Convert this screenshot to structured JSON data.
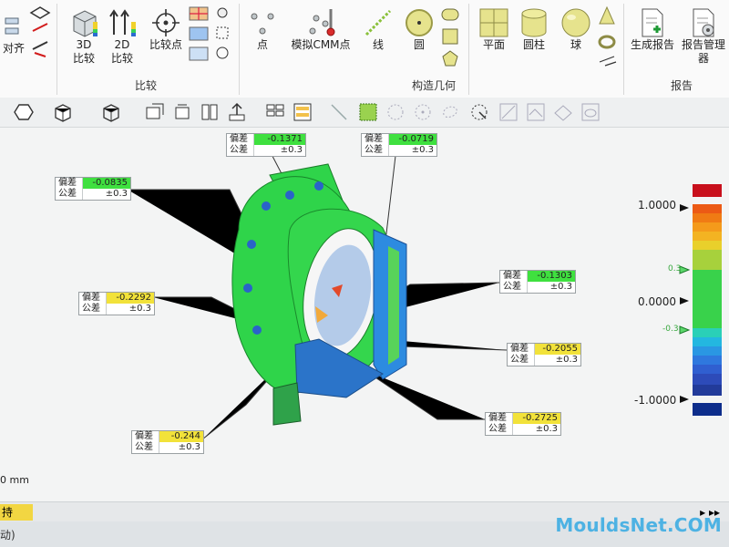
{
  "ribbon": {
    "left_cut_label": "对齐",
    "btn_3d_compare": "3D\n比较",
    "btn_2d_compare": "2D\n比较",
    "btn_compare_point": "比较点",
    "btn_point": "点",
    "btn_sim_cmm": "模拟CMM点",
    "btn_line": "线",
    "btn_circle": "圆",
    "btn_plane": "平面",
    "btn_cylinder": "圆柱",
    "btn_sphere": "球",
    "btn_gen_report": "生成报告",
    "btn_report_mgr": "报告管理器",
    "group_compare": "比较",
    "group_construct": "构造几何",
    "group_report": "报告"
  },
  "labels": {
    "dev": "偏差",
    "tol": "公差"
  },
  "callouts": [
    {
      "dev": "-0.1371",
      "tol": "±0.3",
      "hl": "green"
    },
    {
      "dev": "-0.0719",
      "tol": "±0.3",
      "hl": "green"
    },
    {
      "dev": "-0.0835",
      "tol": "±0.3",
      "hl": "green"
    },
    {
      "dev": "-0.2292",
      "tol": "±0.3",
      "hl": "yellow"
    },
    {
      "dev": "-0.1303",
      "tol": "±0.3",
      "hl": "green"
    },
    {
      "dev": "-0.2055",
      "tol": "±0.3",
      "hl": "yellow"
    },
    {
      "dev": "-0.2725",
      "tol": "±0.3",
      "hl": "yellow"
    },
    {
      "dev": "-0.244",
      "tol": "±0.3",
      "hl": "yellow"
    }
  ],
  "scale": {
    "top_label": "1.0000",
    "mid_label": "0.0000",
    "bottom_label": "-1.0000",
    "upper_tol": "0.3",
    "lower_tol": "-0.3"
  },
  "status": {
    "left_text": "持",
    "bottom_left": "0 mm"
  },
  "bottom": {
    "left_text": "动)"
  },
  "watermark": "MouldsNet.COM",
  "colors": {
    "green": "#3fe03f",
    "yellow": "#f2e23a",
    "part_green": "#2fd44a",
    "part_blue": "#1f68b8",
    "scale_top": "#d4141c",
    "scale_bottom": "#0d2d8b"
  }
}
